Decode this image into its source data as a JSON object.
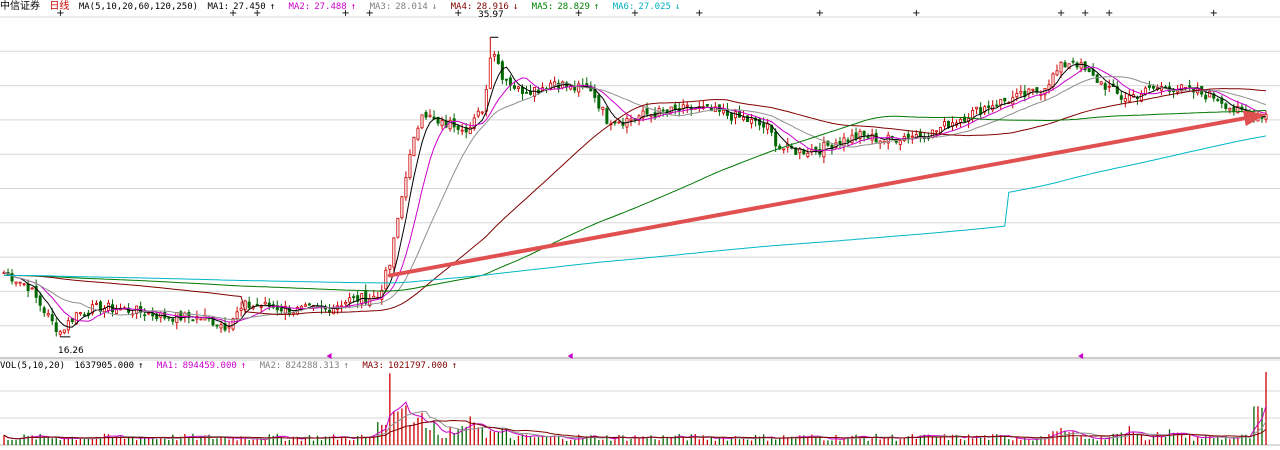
{
  "header": {
    "stock_name": "中信证券",
    "period": "日线",
    "ma_params": "MA(5,10,20,60,120,250)",
    "ma": [
      {
        "label": "MA1:",
        "value": "27.450",
        "arrow": "↑",
        "color": "#000000"
      },
      {
        "label": "MA2:",
        "value": "27.488",
        "arrow": "↑",
        "color": "#cc00cc"
      },
      {
        "label": "MA3:",
        "value": "28.014",
        "arrow": "↓",
        "color": "#808080"
      },
      {
        "label": "MA4:",
        "value": "28.916",
        "arrow": "↓",
        "color": "#800000"
      },
      {
        "label": "MA5:",
        "value": "28.829",
        "arrow": "↑",
        "color": "#008000"
      },
      {
        "label": "MA6:",
        "value": "27.025",
        "arrow": "↓",
        "color": "#00b0c0"
      }
    ]
  },
  "vol_header": {
    "params": "VOL(5,10,20)",
    "value": "1637905.000",
    "value_arrow": "↑",
    "ma": [
      {
        "label": "MA1:",
        "value": "894459.000",
        "arrow": "↑",
        "color": "#cc00cc"
      },
      {
        "label": "MA2:",
        "value": "824288.313",
        "arrow": "↑",
        "color": "#808080"
      },
      {
        "label": "MA3:",
        "value": "1021797.000",
        "arrow": "↑",
        "color": "#800000"
      }
    ]
  },
  "annotations": {
    "high_label": "35.97",
    "low_label": "16.26"
  },
  "colors": {
    "up": "#cc0000",
    "down": "#006600",
    "grid": "#d8d8d8",
    "arrow": "#e05050"
  },
  "chart_data": {
    "type": "candlestick",
    "ylim": [
      15,
      37.5
    ],
    "high": 35.97,
    "low": 16.26,
    "anchors": [
      [
        0,
        20.5
      ],
      [
        6,
        19.6
      ],
      [
        12,
        17.2
      ],
      [
        14,
        16.6
      ],
      [
        18,
        17.8
      ],
      [
        24,
        18.2
      ],
      [
        32,
        18.0
      ],
      [
        40,
        17.6
      ],
      [
        50,
        17.5
      ],
      [
        55,
        17.0
      ],
      [
        60,
        18.3
      ],
      [
        66,
        18.3
      ],
      [
        72,
        18.0
      ],
      [
        80,
        18.1
      ],
      [
        86,
        18.7
      ],
      [
        93,
        18.9
      ],
      [
        96,
        21.0
      ],
      [
        100,
        27.0
      ],
      [
        104,
        31.2
      ],
      [
        108,
        30.2
      ],
      [
        112,
        30.3
      ],
      [
        116,
        30.0
      ],
      [
        119,
        31.3
      ],
      [
        122,
        35.0
      ],
      [
        124,
        33.5
      ],
      [
        128,
        32.5
      ],
      [
        133,
        32.6
      ],
      [
        137,
        33.1
      ],
      [
        141,
        32.6
      ],
      [
        146,
        32.6
      ],
      [
        150,
        30.6
      ],
      [
        154,
        30.5
      ],
      [
        160,
        30.9
      ],
      [
        166,
        31.1
      ],
      [
        172,
        31.3
      ],
      [
        178,
        31.0
      ],
      [
        184,
        30.6
      ],
      [
        190,
        30.0
      ],
      [
        193,
        28.7
      ],
      [
        197,
        28.5
      ],
      [
        203,
        28.6
      ],
      [
        207,
        29.1
      ],
      [
        213,
        29.5
      ],
      [
        219,
        29.2
      ],
      [
        225,
        29.5
      ],
      [
        231,
        29.7
      ],
      [
        235,
        30.3
      ],
      [
        241,
        31.0
      ],
      [
        245,
        31.5
      ],
      [
        252,
        32.0
      ],
      [
        258,
        32.5
      ],
      [
        263,
        34.0
      ],
      [
        266,
        34.5
      ],
      [
        270,
        33.5
      ],
      [
        274,
        32.8
      ],
      [
        278,
        32.0
      ],
      [
        282,
        32.2
      ],
      [
        286,
        32.6
      ],
      [
        290,
        32.7
      ],
      [
        296,
        32.4
      ],
      [
        302,
        32.0
      ],
      [
        306,
        31.2
      ],
      [
        310,
        30.8
      ],
      [
        314,
        30.9
      ]
    ],
    "n_days": 315,
    "ma_series": [
      {
        "label": "MA1",
        "period": 5,
        "color": "#000000"
      },
      {
        "label": "MA2",
        "period": 10,
        "color": "#cc00cc"
      },
      {
        "label": "MA3",
        "period": 20,
        "color": "#909090"
      },
      {
        "label": "MA4",
        "period": 60,
        "color": "#800000"
      },
      {
        "label": "MA5",
        "period": 120,
        "color": "#007700"
      },
      {
        "label": "MA6",
        "period": 250,
        "color": "#00b8c8"
      }
    ],
    "trend_arrow": {
      "from": [
        96,
        20.3
      ],
      "to": [
        314,
        30.9
      ]
    },
    "volume_peaks": [
      [
        96,
        1.0
      ],
      [
        100,
        0.55
      ],
      [
        104,
        0.45
      ],
      [
        116,
        0.4
      ],
      [
        263,
        0.38
      ],
      [
        280,
        0.42
      ],
      [
        290,
        0.35
      ],
      [
        314,
        1.637905
      ]
    ]
  }
}
